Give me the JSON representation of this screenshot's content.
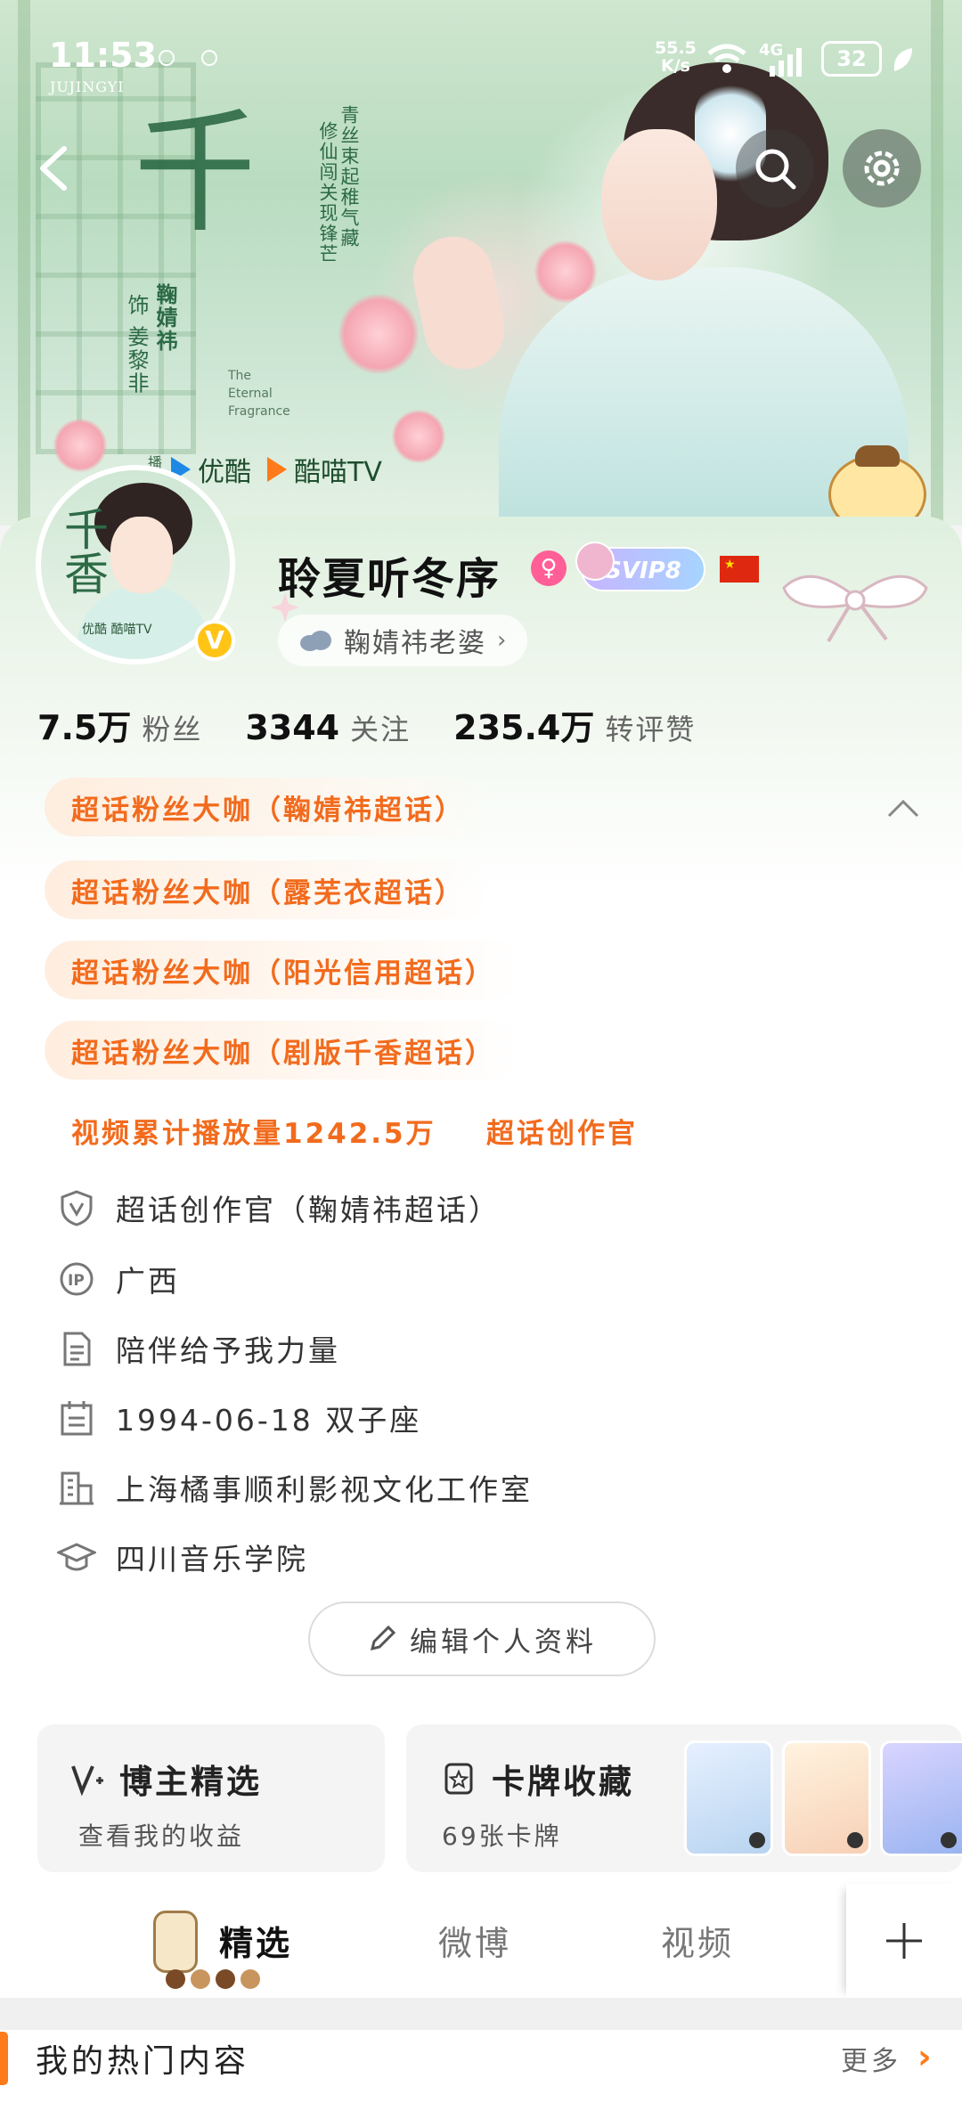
{
  "status_bar": {
    "time": "11:53",
    "carrier_label": "JUJINGYI",
    "speed": "55.5",
    "speed_unit": "K/s",
    "network": "4G",
    "battery": "32"
  },
  "banner": {
    "title": "千香",
    "tagline_1": "青丝束起稚气藏",
    "tagline_2": "修仙闯关现锋芒",
    "actor": "鞠婧祎",
    "role": "饰 姜黎非",
    "english_title": "The\nEternal\nFragrance",
    "platform_prefix": "播出",
    "platforms": [
      "优酷",
      "酷喵TV"
    ]
  },
  "avatar": {
    "title": "千香",
    "platforms": "优酷  酷喵TV"
  },
  "profile": {
    "nickname": "聆夏听冬序",
    "vip_badge": "SVIP8",
    "group_chip": "鞠婧祎老婆",
    "verified": "V"
  },
  "stats": [
    {
      "value": "7.5万",
      "label": "粉丝"
    },
    {
      "value": "3344",
      "label": "关注"
    },
    {
      "value": "235.4万",
      "label": "转评赞"
    }
  ],
  "tags": [
    "超话粉丝大咖（鞠婧祎超话）",
    "超话粉丝大咖（露芜衣超话）",
    "超话粉丝大咖（阳光信用超话）",
    "超话粉丝大咖（剧版千香超话）",
    "视频累计播放量1242.5万",
    "超话创作官"
  ],
  "info": [
    {
      "icon": "shield-v-icon",
      "text": "超话创作官（鞠婧祎超话）"
    },
    {
      "icon": "ip-location-icon",
      "text": "广西"
    },
    {
      "icon": "bio-document-icon",
      "text": "陪伴给予我力量"
    },
    {
      "icon": "calendar-icon",
      "text": "1994-06-18 双子座"
    },
    {
      "icon": "company-building-icon",
      "text": "上海橘事顺利影视文化工作室"
    },
    {
      "icon": "graduation-cap-icon",
      "text": "四川音乐学院"
    }
  ],
  "edit_button": "编辑个人资料",
  "features": {
    "creator_pick": {
      "title": "博主精选",
      "sub": "查看我的收益"
    },
    "card_collection": {
      "title": "卡牌收藏",
      "sub": "69张卡牌"
    }
  },
  "tabs": [
    "精选",
    "微博",
    "视频"
  ],
  "hot": {
    "title": "我的热门内容",
    "more": "更多"
  }
}
